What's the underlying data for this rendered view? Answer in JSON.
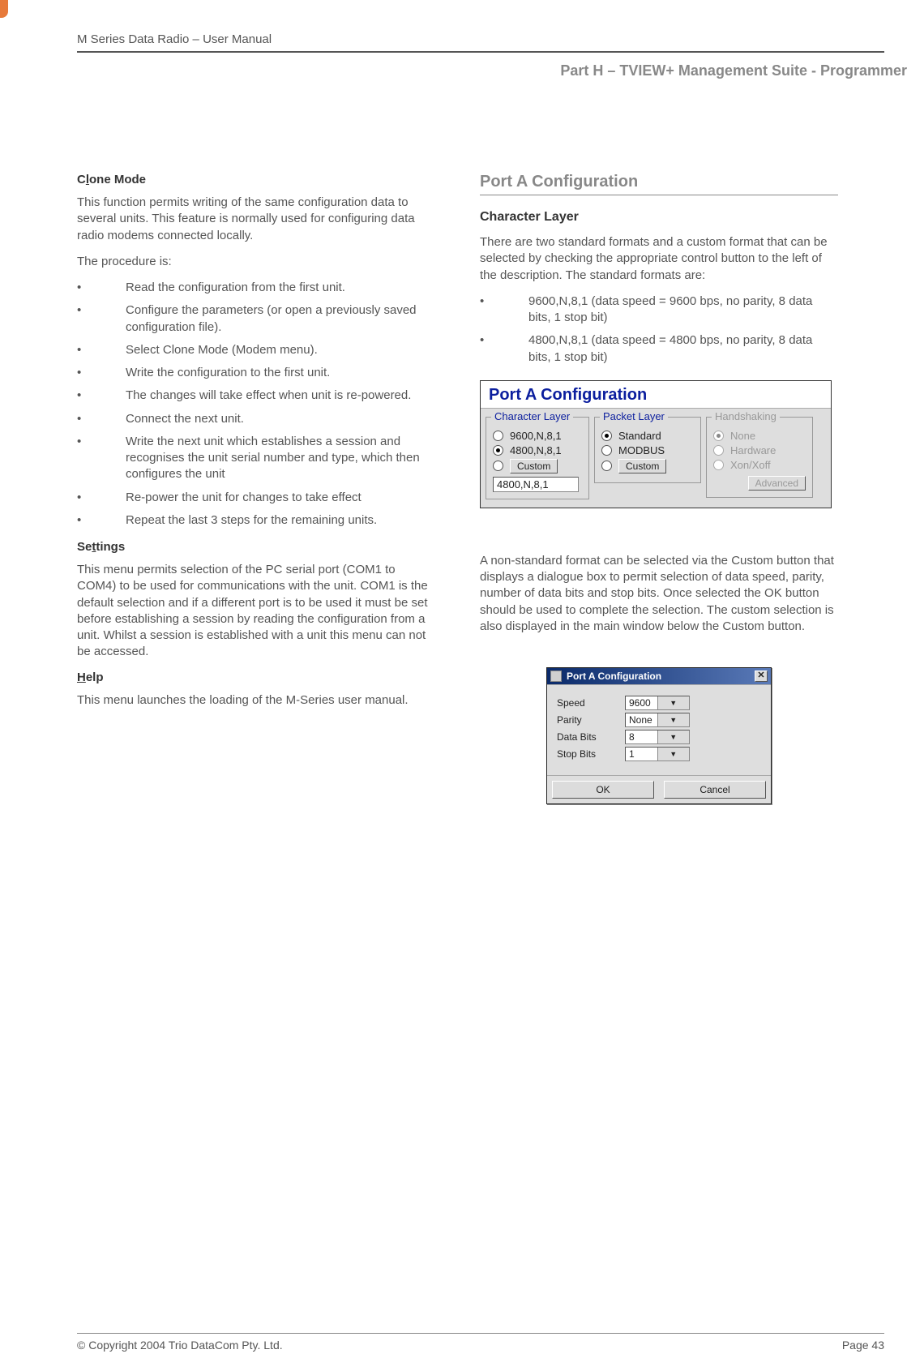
{
  "header": {
    "doc_title": "M Series Data Radio – User Manual",
    "part_title": "Part H – TVIEW+ Management Suite - Programmer"
  },
  "left": {
    "clone_heading_prefix": "C",
    "clone_heading_ul": "l",
    "clone_heading_suffix": "one Mode",
    "clone_para": "This function permits writing of the same configuration data to several units. This feature is normally used for configuring data radio modems connected locally.",
    "procedure_label": "The procedure is:",
    "procedure": [
      "Read the configuration from the first unit.",
      "Configure the parameters (or open a previously saved configuration file).",
      "Select Clone Mode (Modem menu).",
      "Write the configuration to the first unit.",
      "The changes will take effect when unit is re-powered.",
      "Connect the next unit.",
      "Write the next unit which establishes a session and recognises the unit serial number and type, which then configures the unit",
      "Re-power the unit for changes to take effect",
      "Repeat the last 3 steps for the remaining units."
    ],
    "settings_prefix": "Se",
    "settings_ul": "t",
    "settings_suffix": "tings",
    "settings_para": "This menu permits selection of the PC serial port (COM1 to COM4) to be used for communications with the unit. COM1 is the default selection and if a different port is to be used it must be set before establishing a session by reading the configuration from a unit.  Whilst a session is established with a unit this menu can not be accessed.",
    "help_ul": "H",
    "help_suffix": "elp",
    "help_para": "This menu launches the loading of the M-Series user manual."
  },
  "right": {
    "porta_heading": "Port A  Configuration",
    "char_heading": "Character Layer",
    "char_para": "There are two standard formats and a custom format that can be selected by checking the appropriate control button to the left of the description. The standard formats are:",
    "char_bullets": [
      "9600,N,8,1  (data speed = 9600 bps, no parity, 8 data bits, 1 stop bit)",
      "4800,N,8,1  (data speed = 4800 bps, no parity, 8 data bits, 1 stop bit)"
    ],
    "nonstd_para": "A non-standard format can be selected via the Custom button that displays a dialogue box to permit selection of data speed, parity, number of data bits and stop bits. Once selected the OK button should be used to complete the selection. The custom selection is also displayed in the main window below the Custom button."
  },
  "porta_panel": {
    "title": "Port A Configuration",
    "groups": {
      "char": {
        "legend": "Character Layer",
        "opt1": "9600,N,8,1",
        "opt2": "4800,N,8,1",
        "custom_btn": "Custom",
        "field": "4800,N,8,1",
        "selected_index": 1
      },
      "pkt": {
        "legend": "Packet Layer",
        "opt1": "Standard",
        "opt2": "MODBUS",
        "custom_btn": "Custom",
        "selected_index": 0
      },
      "hs": {
        "legend": "Handshaking",
        "opt1": "None",
        "opt2": "Hardware",
        "opt3": "Xon/Xoff",
        "adv_btn": "Advanced",
        "selected_index": 0
      }
    }
  },
  "dlg": {
    "title": "Port A Configuration",
    "rows": {
      "speed": {
        "label": "Speed",
        "value": "9600"
      },
      "parity": {
        "label": "Parity",
        "value": "None"
      },
      "databits": {
        "label": "Data Bits",
        "value": "8"
      },
      "stopbits": {
        "label": "Stop Bits",
        "value": "1"
      }
    },
    "ok": "OK",
    "cancel": "Cancel"
  },
  "footer": {
    "copyright": "© Copyright 2004 Trio DataCom Pty. Ltd.",
    "page": "Page 43"
  }
}
